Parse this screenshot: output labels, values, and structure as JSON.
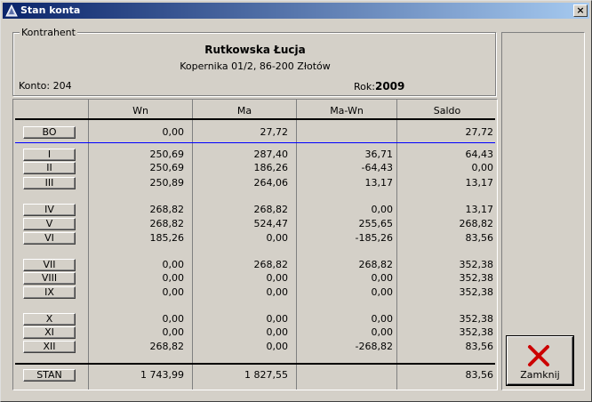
{
  "window": {
    "title": "Stan konta",
    "close_glyph": "×"
  },
  "contractor": {
    "legend": "Kontrahent",
    "name": "Rutkowska Łucja",
    "address": "Kopernika 01/2, 86-200 Złotów",
    "account_label": "Konto:",
    "account_value": "204",
    "year_label": "Rok:",
    "year_value": "2009"
  },
  "table": {
    "headers": [
      "Wn",
      "Ma",
      "Ma-Wn",
      "Saldo"
    ],
    "rows": [
      {
        "label": "BO",
        "wn": "0,00",
        "ma": "27,72",
        "mawn": "",
        "saldo": "27,72"
      },
      {
        "label": "I",
        "wn": "250,69",
        "ma": "287,40",
        "mawn": "36,71",
        "saldo": "64,43"
      },
      {
        "label": "II",
        "wn": "250,69",
        "ma": "186,26",
        "mawn": "-64,43",
        "saldo": "0,00"
      },
      {
        "label": "III",
        "wn": "250,89",
        "ma": "264,06",
        "mawn": "13,17",
        "saldo": "13,17"
      },
      {
        "label": "IV",
        "wn": "268,82",
        "ma": "268,82",
        "mawn": "0,00",
        "saldo": "13,17"
      },
      {
        "label": "V",
        "wn": "268,82",
        "ma": "524,47",
        "mawn": "255,65",
        "saldo": "268,82"
      },
      {
        "label": "VI",
        "wn": "185,26",
        "ma": "0,00",
        "mawn": "-185,26",
        "saldo": "83,56"
      },
      {
        "label": "VII",
        "wn": "0,00",
        "ma": "268,82",
        "mawn": "268,82",
        "saldo": "352,38"
      },
      {
        "label": "VIII",
        "wn": "0,00",
        "ma": "0,00",
        "mawn": "0,00",
        "saldo": "352,38"
      },
      {
        "label": "IX",
        "wn": "0,00",
        "ma": "0,00",
        "mawn": "0,00",
        "saldo": "352,38"
      },
      {
        "label": "X",
        "wn": "0,00",
        "ma": "0,00",
        "mawn": "0,00",
        "saldo": "352,38"
      },
      {
        "label": "XI",
        "wn": "0,00",
        "ma": "0,00",
        "mawn": "0,00",
        "saldo": "352,38"
      },
      {
        "label": "XII",
        "wn": "268,82",
        "ma": "0,00",
        "mawn": "-268,82",
        "saldo": "83,56"
      },
      {
        "label": "STAN",
        "wn": "1 743,99",
        "ma": "1 827,55",
        "mawn": "",
        "saldo": "83,56"
      }
    ]
  },
  "buttons": {
    "close_label": "Zamknij",
    "close_icon": "red-x-icon"
  },
  "colors": {
    "titlebar_start": "#0a246a",
    "titlebar_end": "#a6caf0",
    "separator": "#0000ff",
    "close_x": "#cc0000"
  }
}
